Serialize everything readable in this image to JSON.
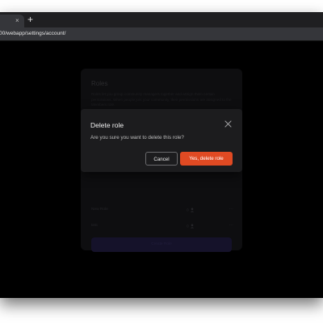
{
  "browser": {
    "tab_close_glyph": "×",
    "new_tab_glyph": "+",
    "url": "00/webapp/settings/account/"
  },
  "background_card": {
    "title": "Roles",
    "description": "Roles let you group community managers together and assign them certain permissions. When people join your community, their permissions are assigned to the Members role.",
    "rows": [
      {
        "name": "New Role",
        "count": "0",
        "more": "⋯"
      },
      {
        "name": "test",
        "count": "0",
        "more": "⋯"
      }
    ],
    "create_button": "Create Role"
  },
  "modal": {
    "title": "Delete role",
    "body": "Are you sure you want to delete this role?",
    "cancel_label": "Cancel",
    "confirm_label": "Yes, delete role",
    "confirm_color": "#e04a23"
  },
  "icons": {
    "close": "close-icon",
    "users": "users-icon",
    "more": "more-icon"
  }
}
